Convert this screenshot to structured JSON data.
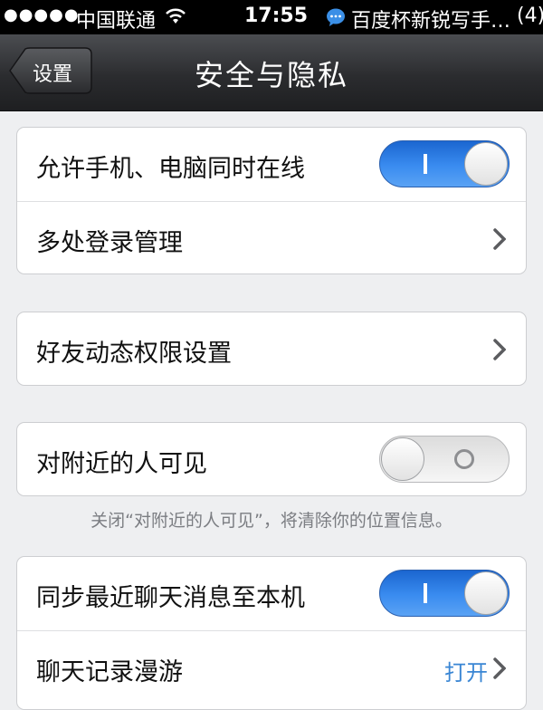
{
  "status_bar": {
    "signal": "●●●●●",
    "carrier": "中国联通",
    "time": "17:55",
    "notification": "百度杯新锐写手…",
    "notification_count": "(4)"
  },
  "navbar": {
    "back_label": "设置",
    "title": "安全与隐私"
  },
  "groups": [
    {
      "rows": [
        {
          "label": "允许手机、电脑同时在线",
          "toggle": "on"
        },
        {
          "label": "多处登录管理",
          "accessory": "chevron"
        }
      ]
    },
    {
      "rows": [
        {
          "label": "好友动态权限设置",
          "accessory": "chevron"
        }
      ]
    },
    {
      "rows": [
        {
          "label": "对附近的人可见",
          "toggle": "off"
        }
      ],
      "footnote": "关闭“对附近的人可见”，将清除你的位置信息。"
    },
    {
      "rows": [
        {
          "label": "同步最近聊天消息至本机",
          "toggle": "on"
        },
        {
          "label": "聊天记录漫游",
          "value": "打开",
          "accessory": "chevron"
        }
      ]
    }
  ],
  "colors": {
    "accent": "#3a86d4",
    "toggle_on": "#2f7de6",
    "background": "#eeeff1"
  }
}
